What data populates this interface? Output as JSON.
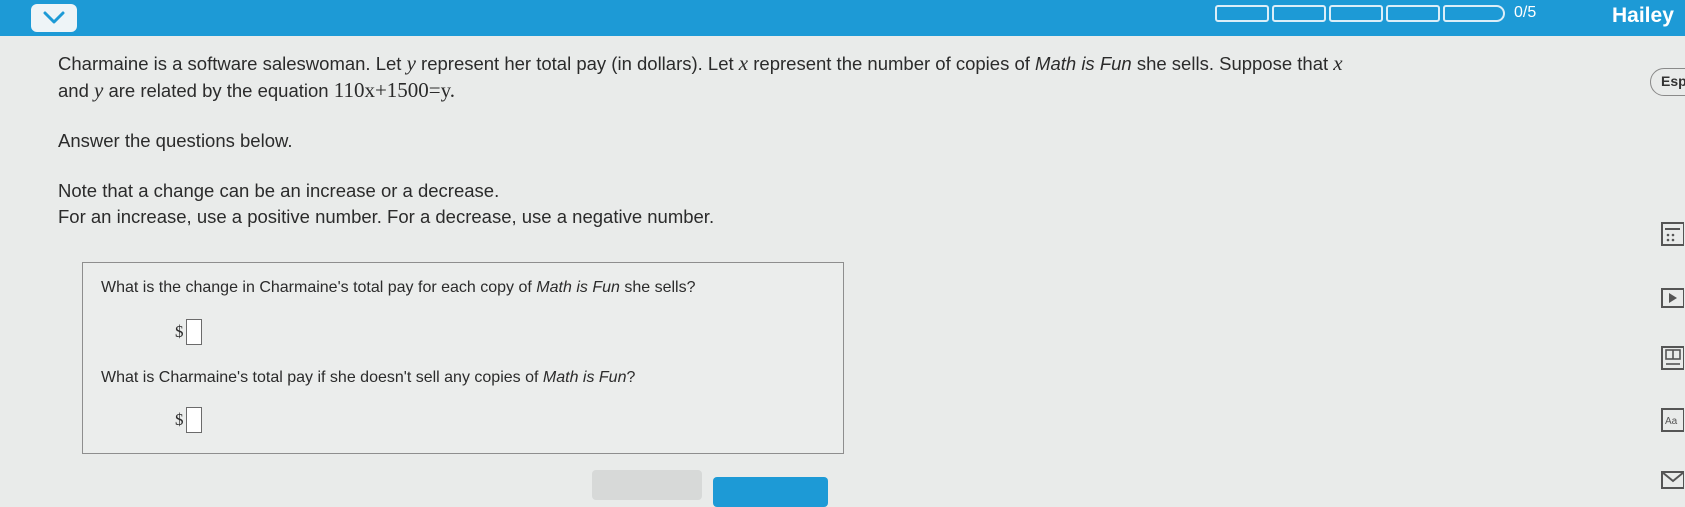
{
  "header": {
    "progress_label": "0/5",
    "progress_segments": 5,
    "progress_filled": 0,
    "user_name": "Hailey",
    "accent_color": "#1d9ad6"
  },
  "problem": {
    "sentence1": "Charmaine is a software saleswoman. Let ",
    "var_y": "y",
    "sentence1b": " represent her total pay (in dollars). Let ",
    "var_x": "x",
    "sentence1c": " represent the number of copies of ",
    "product": "Math is Fun",
    "sentence1d": " she sells. Suppose that ",
    "sentence2a": "and ",
    "sentence2b": " are related by the equation ",
    "equation": "110x+1500=y.",
    "instruction": "Answer the questions below.",
    "note1": "Note that a change can be an increase or a decrease.",
    "note2": "For an increase, use a positive number. For a decrease, use a negative number."
  },
  "questions": [
    {
      "text_a": "What is the change in Charmaine's total pay for each copy of ",
      "product": "Math is Fun",
      "text_b": " she sells?",
      "prefix": "$",
      "value": ""
    },
    {
      "text_a": "What is Charmaine's total pay if she doesn't sell any copies of ",
      "product": "Math is Fun",
      "text_b": "?",
      "prefix": "$",
      "value": ""
    }
  ],
  "sidebar": {
    "language_button": "Esp",
    "icons": [
      "calculator-icon",
      "video-icon",
      "grid-icon",
      "text-size-icon",
      "mail-icon"
    ]
  }
}
